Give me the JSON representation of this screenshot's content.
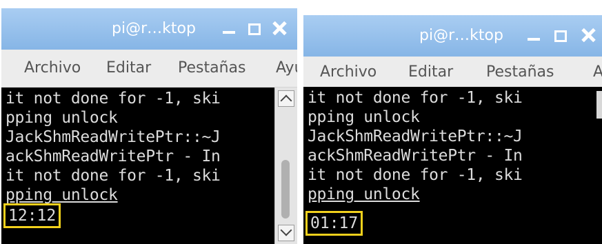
{
  "windows": [
    {
      "title": "pi@r…ktop",
      "menu": [
        "Archivo",
        "Editar",
        "Pestañas",
        "Ayu"
      ],
      "lines": [
        "it not done for -1, ski",
        "pping unlock",
        "JackShmReadWritePtr::~J",
        "ackShmReadWritePtr - In",
        "it not done for -1, ski",
        "pping unlock"
      ],
      "clock": "12:12"
    },
    {
      "title": "pi@r…ktop",
      "menu": [
        "Archivo",
        "Editar",
        "Pestañas",
        "A"
      ],
      "lines": [
        "it not done for -1, ski",
        "pping unlock",
        "JackShmReadWritePtr::~J",
        "ackShmReadWritePtr - In",
        "it not done for -1, ski",
        "pping unlock"
      ],
      "clock": "01:17"
    }
  ],
  "colors": {
    "titlebar": "#9cc4ee",
    "terminal_bg": "#000000",
    "terminal_text": "#dcdcdc",
    "highlight_box": "#f2d11c"
  }
}
